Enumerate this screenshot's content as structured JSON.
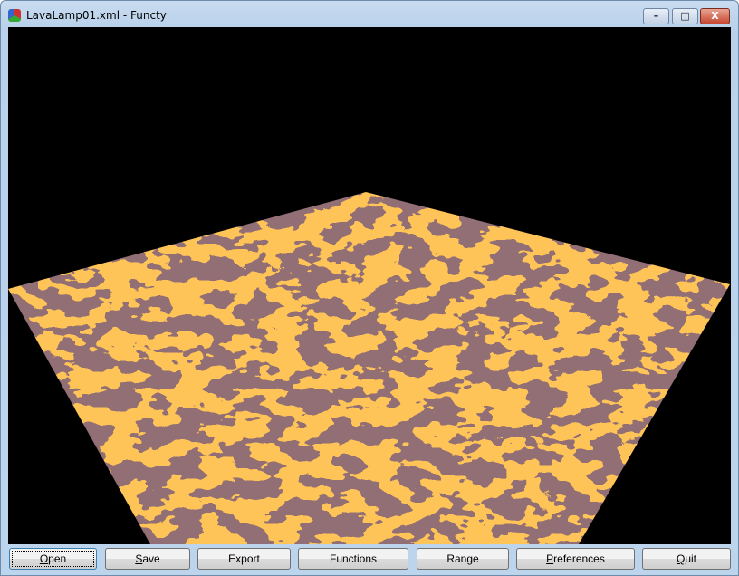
{
  "window": {
    "title": "LavaLamp01.xml - Functy",
    "icon": "functy-app-icon"
  },
  "controls": {
    "minimize": "–",
    "maximize": "□",
    "close": "X"
  },
  "scene": {
    "colors": {
      "background": "#000000",
      "lava": "#ff8c1a",
      "rock": "#4a2a2e"
    }
  },
  "buttons": [
    {
      "key": "O",
      "rest": "pen",
      "label": "Open"
    },
    {
      "key": "S",
      "rest": "ave",
      "label": "Save"
    },
    {
      "key": "",
      "rest": "Export",
      "label": "Export"
    },
    {
      "key": "",
      "rest": "Functions",
      "label": "Functions"
    },
    {
      "key": "",
      "rest": "Range",
      "label": "Range"
    },
    {
      "key": "P",
      "rest": "references",
      "label": "Preferences"
    },
    {
      "key": "Q",
      "rest": "uit",
      "label": "Quit"
    }
  ]
}
